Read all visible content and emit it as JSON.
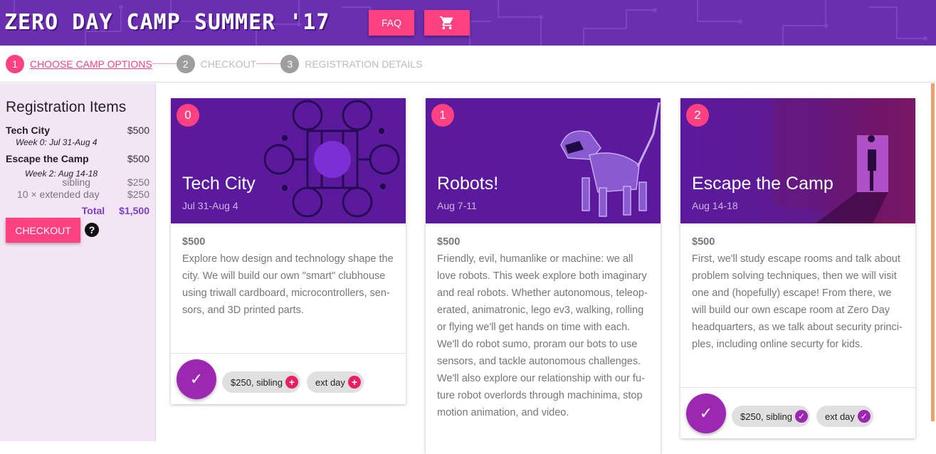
{
  "header": {
    "title": "ZERO DAY CAMP SUMMER '17",
    "faq_label": "FAQ",
    "cart_icon": "cart-icon",
    "bg_color": "#6a2fb0",
    "accent_color": "#ff4081"
  },
  "stepper": {
    "steps": [
      {
        "number": "1",
        "label": "CHOOSE CAMP OPTIONS",
        "active": true
      },
      {
        "number": "2",
        "label": "CHECKOUT",
        "active": false
      },
      {
        "number": "3",
        "label": "REGISTRATION DETAILS",
        "active": false
      }
    ]
  },
  "sidebar": {
    "heading": "Registration Items",
    "items": [
      {
        "name": "Tech City",
        "price": "$500",
        "week": "Week 0: Jul 31-Aug 4"
      },
      {
        "name": "Escape the Camp",
        "price": "$500",
        "week": "Week 2: Aug 14-18",
        "extras": [
          {
            "label": "sibling",
            "price": "$250"
          },
          {
            "label": "10 × extended day",
            "price": "$250"
          }
        ]
      }
    ],
    "total_label": "Total",
    "total_value": "$1,500",
    "checkout_label": "CHECKOUT",
    "help_label": "?"
  },
  "cards": [
    {
      "index": "0",
      "title": "Tech City",
      "dates": "Jul 31-Aug 4",
      "price": "$500",
      "description": "Explore how design and technology shape the city. We will build our own \"smart\" clubhouse using triwall cardboard, microcontrollers, sen­sors, and 3D printed parts.",
      "chips": [
        {
          "label": "$250, sibling",
          "icon": "plus"
        },
        {
          "label": "ext day",
          "icon": "plus"
        }
      ]
    },
    {
      "index": "1",
      "title": "Robots!",
      "dates": "Aug 7-11",
      "price": "$500",
      "description": "Friendly, evil, humanlike or machine: we all love robots. This week explore both imaginary and real robots. Whether autonomous, teleop­erated, animatronic, lego ev3, walking, rolling or flying we'll get hands on time with each. We'll do robot sumo, proram our bots to use sensors, and tackle autonomous challenges. We'll also explore our relationship with our fu­ture robot overlords through machinima, stop motion animation, and video."
    },
    {
      "index": "2",
      "title": "Escape the Camp",
      "dates": "Aug 14-18",
      "price": "$500",
      "description": "First, we'll study escape rooms and talk about problem solving techniques, then we will visit one and (hopefully) escape! From there, we will build our own escape room at Zero Day headquarters, as we talk about security princi­ples, including online securty for kids.",
      "chips": [
        {
          "label": "$250, sibling",
          "icon": "check"
        },
        {
          "label": "ext day",
          "icon": "check"
        }
      ]
    }
  ]
}
